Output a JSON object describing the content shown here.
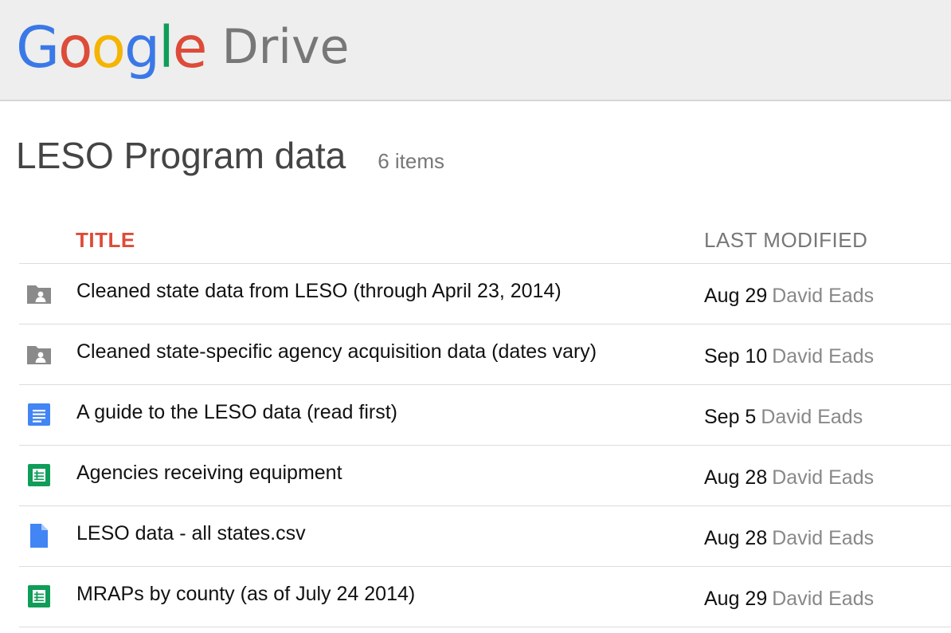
{
  "app": {
    "logo_letters": [
      "G",
      "o",
      "o",
      "g",
      "l",
      "e"
    ],
    "product_name": "Drive"
  },
  "folder": {
    "title": "LESO Program data",
    "item_count": "6 items"
  },
  "columns": {
    "title": "TITLE",
    "last_modified": "LAST MODIFIED"
  },
  "files": [
    {
      "icon": "shared-folder-icon",
      "title": "Cleaned state data from LESO (through April 23, 2014)",
      "date": "Aug 29",
      "owner": "David Eads"
    },
    {
      "icon": "shared-folder-icon",
      "title": "Cleaned state-specific agency acquisition data (dates vary)",
      "date": "Sep 10",
      "owner": "David Eads"
    },
    {
      "icon": "document-icon",
      "title": "A guide to the LESO data (read first)",
      "date": "Sep 5",
      "owner": "David Eads"
    },
    {
      "icon": "spreadsheet-icon",
      "title": "Agencies receiving equipment",
      "date": "Aug 28",
      "owner": "David Eads"
    },
    {
      "icon": "file-icon",
      "title": "LESO data - all states.csv",
      "date": "Aug 28",
      "owner": "David Eads"
    },
    {
      "icon": "spreadsheet-icon",
      "title": "MRAPs by county (as of July 24 2014)",
      "date": "Aug 29",
      "owner": "David Eads"
    }
  ],
  "colors": {
    "title_header": "#dd4b39",
    "folder_icon": "#8a8a8a",
    "document_icon": "#4285f4",
    "spreadsheet_icon": "#0f9d58",
    "file_icon": "#4285f4"
  }
}
